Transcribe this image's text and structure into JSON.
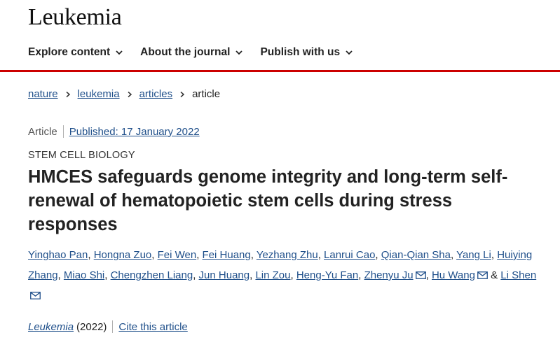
{
  "site": {
    "logo": "Leukemia"
  },
  "nav": {
    "items": [
      {
        "label": "Explore content"
      },
      {
        "label": "About the journal"
      },
      {
        "label": "Publish with us"
      }
    ]
  },
  "breadcrumb": {
    "items": [
      "nature",
      "leukemia",
      "articles"
    ],
    "current": "article"
  },
  "article": {
    "type": "Article",
    "published": "Published: 17 January 2022",
    "subject": "STEM CELL BIOLOGY",
    "title": "HMCES safeguards genome integrity and long-term self-renewal of hematopoietic stem cells during stress responses",
    "authors": [
      "Yinghao Pan",
      "Hongna Zuo",
      "Fei Wen",
      "Fei Huang",
      "Yezhang Zhu",
      "Lanrui Cao",
      "Qian-Qian Sha",
      "Yang Li",
      "Huiying Zhang",
      "Miao Shi",
      "Chengzhen Liang",
      "Jun Huang",
      "Lin Zou",
      "Heng-Yu Fan",
      "Zhenyu Ju",
      "Hu Wang",
      "Li Shen"
    ],
    "separator": ",",
    "ampersand": "&",
    "journal": "Leukemia",
    "year": "(2022)",
    "cite_label": "Cite this article"
  },
  "colors": {
    "accent": "#cc0000",
    "link": "#1f4f8a",
    "text": "#222222"
  },
  "icons": {
    "nav_chevron": "chevron-down-icon",
    "crumb_sep": "chevron-right-icon",
    "email": "envelope-icon"
  }
}
